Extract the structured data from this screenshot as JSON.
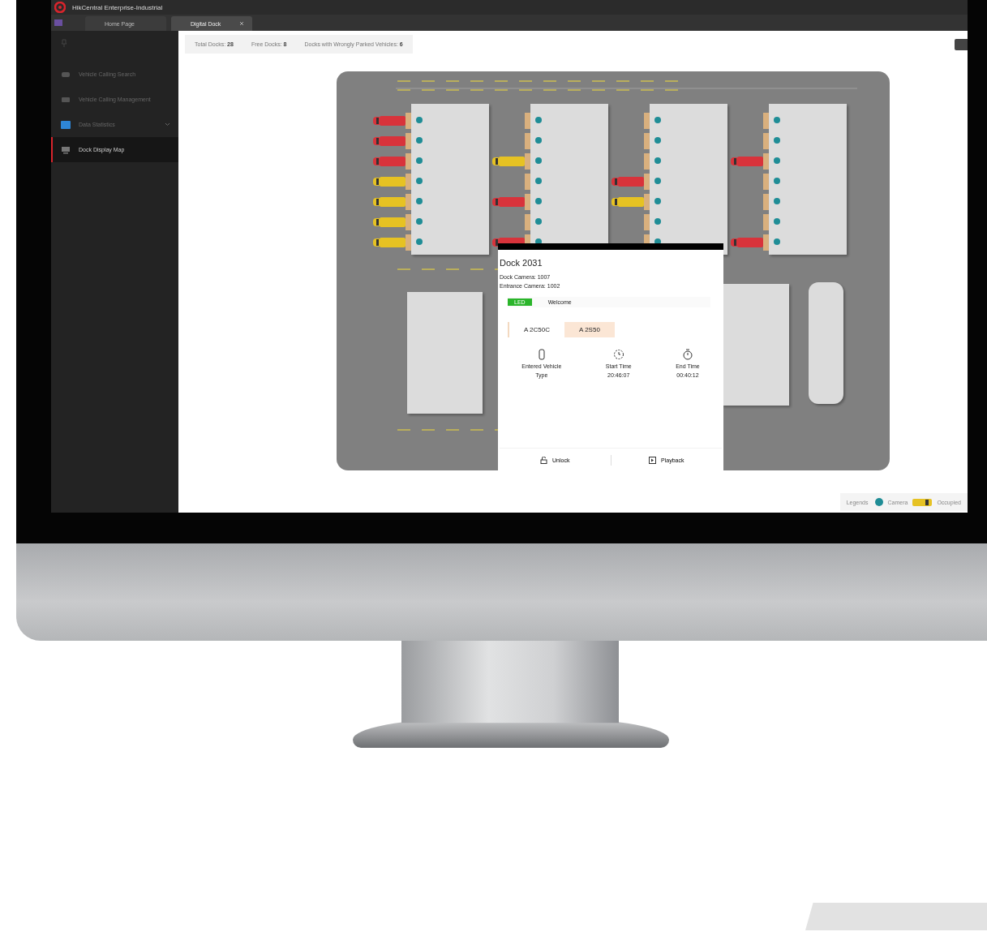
{
  "app": {
    "title": "HikCentral Enterprise-Industrial"
  },
  "tabs": [
    {
      "label": "Home Page",
      "selected": false,
      "closable": false
    },
    {
      "label": "Digital Dock",
      "selected": true,
      "closable": true
    }
  ],
  "sidebar": {
    "items": [
      {
        "label": "Vehicle Calling Search",
        "selected": false,
        "expandable": false
      },
      {
        "label": "Vehicle Calling Management",
        "selected": false,
        "expandable": false
      },
      {
        "label": "Data Statistics",
        "selected": false,
        "expandable": true
      },
      {
        "label": "Dock Display Map",
        "selected": true,
        "expandable": false
      }
    ]
  },
  "summary": [
    {
      "label": "Total Docks:",
      "value": "28"
    },
    {
      "label": "Free Docks:",
      "value": "8"
    },
    {
      "label": "Docks with Wrongly Parked Vehicles:",
      "value": "6"
    }
  ],
  "map": {
    "buildings": [
      {
        "docks": [
          {
            "kind": "wrong"
          },
          {
            "kind": "wrong"
          },
          {
            "kind": "wrong"
          },
          {
            "kind": "occupied"
          },
          {
            "kind": "occupied"
          },
          {
            "kind": "occupied"
          },
          {
            "kind": "occupied"
          }
        ]
      },
      {
        "docks": [
          {
            "kind": "free"
          },
          {
            "kind": "free"
          },
          {
            "kind": "occupied"
          },
          {
            "kind": "free"
          },
          {
            "kind": "wrong"
          },
          {
            "kind": "free"
          },
          {
            "kind": "wrong"
          }
        ]
      },
      {
        "docks": [
          {
            "kind": "free"
          },
          {
            "kind": "free"
          },
          {
            "kind": "free"
          },
          {
            "kind": "wrong"
          },
          {
            "kind": "occupied"
          },
          {
            "kind": "free"
          },
          {
            "kind": "free"
          }
        ]
      },
      {
        "docks": [
          {
            "kind": "free"
          },
          {
            "kind": "free"
          },
          {
            "kind": "wrong"
          },
          {
            "kind": "free"
          },
          {
            "kind": "free"
          },
          {
            "kind": "free"
          },
          {
            "kind": "wrong"
          }
        ]
      }
    ]
  },
  "popup": {
    "title": "Dock 2031",
    "fields": [
      {
        "label": "Dock Camera:",
        "value": "1007"
      },
      {
        "label": "Entrance Camera:",
        "value": "1002"
      }
    ],
    "display": {
      "badge": "LED",
      "text": "Welcome"
    },
    "plates": [
      {
        "text": "A 2C50C",
        "selected": false
      },
      {
        "text": "A 2S50",
        "selected": true
      }
    ],
    "stats": [
      {
        "kind": "device",
        "label": "Entered Vehicle",
        "value": "Type"
      },
      {
        "kind": "clock",
        "label": "Start Time",
        "value": "20:46:07"
      },
      {
        "kind": "timer",
        "label": "End Time",
        "value": "00:40:12"
      }
    ],
    "actions": [
      {
        "kind": "unlock",
        "label": "Unlock"
      },
      {
        "kind": "playback",
        "label": "Playback"
      }
    ]
  },
  "legend": {
    "title": "Legends",
    "items": [
      {
        "kind": "camera",
        "label": "Camera"
      },
      {
        "kind": "occupied",
        "label": "Occupied"
      }
    ]
  }
}
